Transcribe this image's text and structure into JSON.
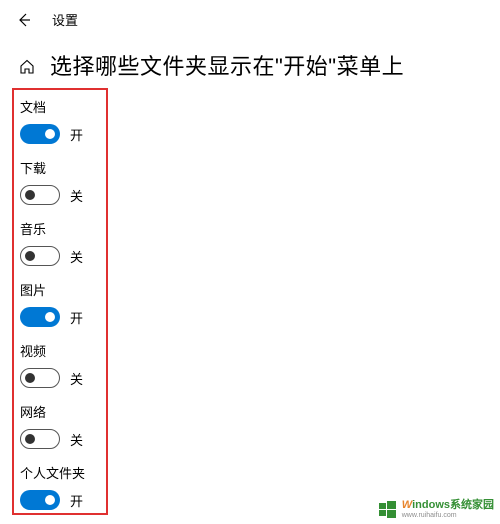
{
  "header": {
    "back_label": "返回",
    "title": "设置"
  },
  "page": {
    "title": "选择哪些文件夹显示在\"开始\"菜单上"
  },
  "labels": {
    "on": "开",
    "off": "关"
  },
  "items": [
    {
      "name": "文档",
      "on": true
    },
    {
      "name": "下载",
      "on": false
    },
    {
      "name": "音乐",
      "on": false
    },
    {
      "name": "图片",
      "on": true
    },
    {
      "name": "视频",
      "on": false
    },
    {
      "name": "网络",
      "on": false
    },
    {
      "name": "个人文件夹",
      "on": true
    }
  ],
  "watermark": {
    "main_prefix": "W",
    "main_rest": "indows系统家园",
    "sub": "www.ruihaifu.com"
  },
  "colors": {
    "accent": "#0078d4",
    "highlight_border": "#e03030"
  }
}
